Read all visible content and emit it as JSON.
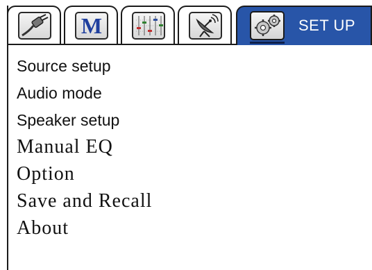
{
  "tabs": [
    {
      "icon": "cable-plug-icon"
    },
    {
      "icon": "m-mode-icon",
      "glyph": "M",
      "glyph_color": "#1f3f9e"
    },
    {
      "icon": "equalizer-sliders-icon"
    },
    {
      "icon": "satellite-dish-icon"
    }
  ],
  "active_tab": {
    "icon": "gears-icon",
    "label": "SET UP",
    "background_color": "#2855a8",
    "text_color": "#ffffff"
  },
  "menu": {
    "items": [
      {
        "label": "Source setup"
      },
      {
        "label": "Audio mode"
      },
      {
        "label": "Speaker setup"
      },
      {
        "label": "Manual EQ"
      },
      {
        "label": "Option"
      },
      {
        "label": "Save and Recall"
      },
      {
        "label": "About"
      }
    ]
  }
}
